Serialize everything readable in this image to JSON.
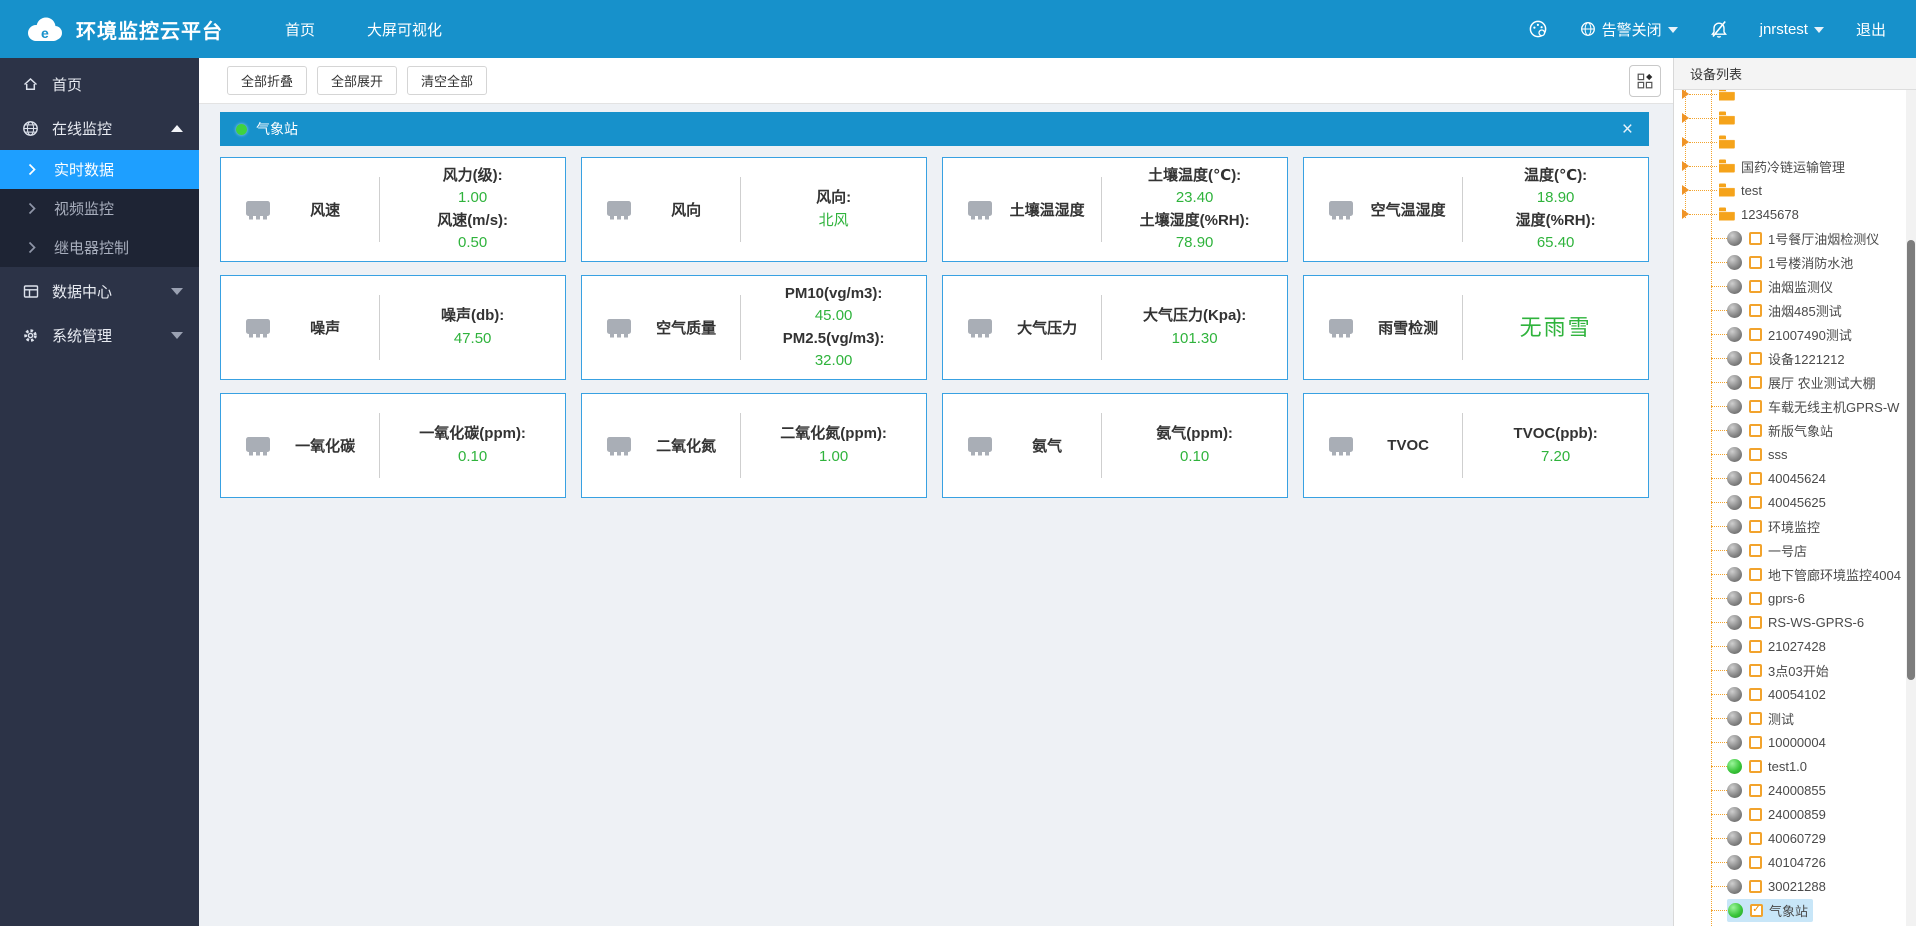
{
  "navbar": {
    "title": "环境监控云平台",
    "links": [
      {
        "label": "首页"
      },
      {
        "label": "大屏可视化"
      }
    ],
    "alarm_label": "告警关闭",
    "username": "jnrstest",
    "logout_label": "退出"
  },
  "sidebar": {
    "items": [
      {
        "label": "首页",
        "icon": "home-icon"
      },
      {
        "label": "在线监控",
        "icon": "globe-icon",
        "expanded": true
      },
      {
        "label": "实时数据",
        "icon": "chevron-right-icon",
        "active": true
      },
      {
        "label": "视频监控",
        "icon": "chevron-right-icon"
      },
      {
        "label": "继电器控制",
        "icon": "chevron-right-icon"
      },
      {
        "label": "数据中心",
        "icon": "table-icon",
        "collapsed": true
      },
      {
        "label": "系统管理",
        "icon": "gear-icon",
        "collapsed": true
      }
    ]
  },
  "toolbar": {
    "buttons": [
      {
        "label": "全部折叠"
      },
      {
        "label": "全部展开"
      },
      {
        "label": "清空全部"
      }
    ]
  },
  "panel": {
    "title": "气象站"
  },
  "cards": [
    {
      "name": "风速",
      "readings": [
        {
          "label": "风力(级):",
          "value": "1.00"
        },
        {
          "label": "风速(m/s):",
          "value": "0.50"
        }
      ]
    },
    {
      "name": "风向",
      "readings": [
        {
          "label": "风向:",
          "value": "北风"
        }
      ]
    },
    {
      "name": "土壤温湿度",
      "readings": [
        {
          "label": "土壤温度(℃):",
          "value": "23.40"
        },
        {
          "label": "土壤湿度(%RH):",
          "value": "78.90"
        }
      ]
    },
    {
      "name": "空气温湿度",
      "readings": [
        {
          "label": "温度(℃):",
          "value": "18.90"
        },
        {
          "label": "湿度(%RH):",
          "value": "65.40"
        }
      ]
    },
    {
      "name": "噪声",
      "readings": [
        {
          "label": "噪声(db):",
          "value": "47.50"
        }
      ]
    },
    {
      "name": "空气质量",
      "readings": [
        {
          "label": "PM10(vg/m3):",
          "value": "45.00"
        },
        {
          "label": "PM2.5(vg/m3):",
          "value": "32.00"
        }
      ]
    },
    {
      "name": "大气压力",
      "readings": [
        {
          "label": "大气压力(Kpa):",
          "value": "101.30"
        }
      ]
    },
    {
      "name": "雨雪检测",
      "big_value": "无雨雪"
    },
    {
      "name": "一氧化碳",
      "readings": [
        {
          "label": "一氧化碳(ppm):",
          "value": "0.10"
        }
      ]
    },
    {
      "name": "二氧化氮",
      "readings": [
        {
          "label": "二氧化氮(ppm):",
          "value": "1.00"
        }
      ]
    },
    {
      "name": "氨气",
      "readings": [
        {
          "label": "氨气(ppm):",
          "value": "0.10"
        }
      ]
    },
    {
      "name": "TVOC",
      "readings": [
        {
          "label": "TVOC(ppb):",
          "value": "7.20"
        }
      ]
    }
  ],
  "device_panel": {
    "title": "设备列表",
    "tree": [
      {
        "type": "folder",
        "label": "",
        "clipped": true
      },
      {
        "type": "folder",
        "label": ""
      },
      {
        "type": "folder",
        "label": ""
      },
      {
        "type": "folder",
        "label": "国药冷链运输管理"
      },
      {
        "type": "folder",
        "label": "test"
      },
      {
        "type": "folder",
        "label": "12345678"
      },
      {
        "type": "device",
        "label": "1号餐厅油烟检测仪",
        "status": "offline"
      },
      {
        "type": "device",
        "label": "1号楼消防水池",
        "status": "offline"
      },
      {
        "type": "device",
        "label": "油烟监测仪",
        "status": "offline"
      },
      {
        "type": "device",
        "label": "油烟485测试",
        "status": "offline"
      },
      {
        "type": "device",
        "label": "21007490测试",
        "status": "offline"
      },
      {
        "type": "device",
        "label": "设备1221212",
        "status": "offline"
      },
      {
        "type": "device",
        "label": "展厅 农业测试大棚",
        "status": "offline"
      },
      {
        "type": "device",
        "label": "车载无线主机GPRS-W",
        "status": "offline"
      },
      {
        "type": "device",
        "label": "新版气象站",
        "status": "offline"
      },
      {
        "type": "device",
        "label": "sss",
        "status": "offline"
      },
      {
        "type": "device",
        "label": "40045624",
        "status": "offline"
      },
      {
        "type": "device",
        "label": "40045625",
        "status": "offline"
      },
      {
        "type": "device",
        "label": "环境监控",
        "status": "offline"
      },
      {
        "type": "device",
        "label": "一号店",
        "status": "offline"
      },
      {
        "type": "device",
        "label": "地下管廊环境监控4004",
        "status": "offline"
      },
      {
        "type": "device",
        "label": "gprs-6",
        "status": "offline"
      },
      {
        "type": "device",
        "label": "RS-WS-GPRS-6",
        "status": "offline"
      },
      {
        "type": "device",
        "label": "21027428",
        "status": "offline"
      },
      {
        "type": "device",
        "label": "3点03开始",
        "status": "offline"
      },
      {
        "type": "device",
        "label": "40054102",
        "status": "offline"
      },
      {
        "type": "device",
        "label": "测试",
        "status": "offline"
      },
      {
        "type": "device",
        "label": "10000004",
        "status": "offline"
      },
      {
        "type": "device",
        "label": "test1.0",
        "status": "online"
      },
      {
        "type": "device",
        "label": "24000855",
        "status": "offline"
      },
      {
        "type": "device",
        "label": "24000859",
        "status": "offline"
      },
      {
        "type": "device",
        "label": "40060729",
        "status": "offline"
      },
      {
        "type": "device",
        "label": "40104726",
        "status": "offline"
      },
      {
        "type": "device",
        "label": "30021288",
        "status": "offline"
      },
      {
        "type": "device",
        "label": "气象站",
        "status": "online",
        "checked": true,
        "selected": true
      }
    ]
  },
  "colors": {
    "primary_blue": "#1791cb",
    "active_blue": "#1e9fff",
    "value_green": "#2fb33c",
    "tree_orange": "#f2a32c",
    "online_green": "#3fd23f"
  }
}
